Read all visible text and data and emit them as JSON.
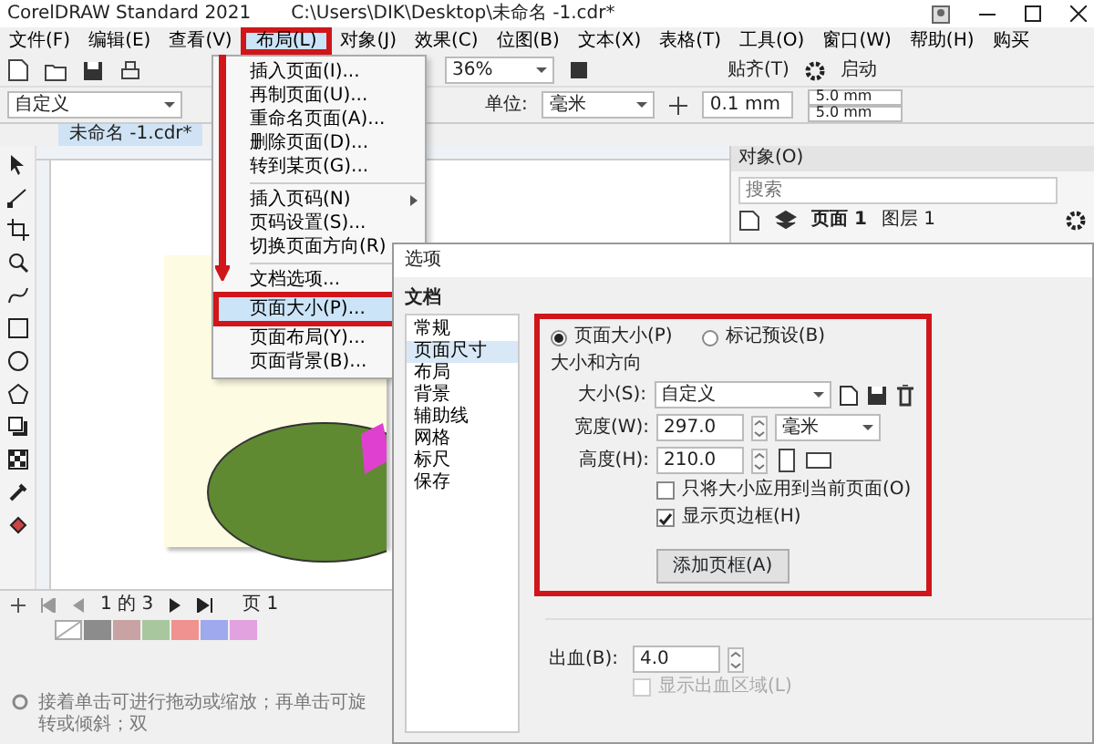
{
  "window": {
    "app_title": "CorelDRAW Standard 2021",
    "file_path": "C:\\Users\\DIK\\Desktop\\未命名 -1.cdr*"
  },
  "menu_bar": [
    {
      "label": "文件(F)",
      "selected": false
    },
    {
      "label": "编辑(E)",
      "selected": false
    },
    {
      "label": "查看(V)",
      "selected": false
    },
    {
      "label": "布局(L)",
      "selected": true
    },
    {
      "label": "对象(J)",
      "selected": false
    },
    {
      "label": "效果(C)",
      "selected": false
    },
    {
      "label": "位图(B)",
      "selected": false
    },
    {
      "label": "文本(X)",
      "selected": false
    },
    {
      "label": "表格(T)",
      "selected": false
    },
    {
      "label": "工具(O)",
      "selected": false
    },
    {
      "label": "窗口(W)",
      "selected": false
    },
    {
      "label": "帮助(H)",
      "selected": false
    },
    {
      "label": "购买",
      "selected": false
    }
  ],
  "toolbar": {
    "zoom": "36%",
    "snap": "贴齐(T)",
    "launch": "启动"
  },
  "property_bar": {
    "preset": "自定义",
    "unit_label": "单位:",
    "unit": "毫米",
    "nudge": "0.1 mm",
    "duplicate_x": "5.0 mm",
    "duplicate_y": "5.0 mm"
  },
  "document_tab": "未命名 -1.cdr*",
  "objects_docker": {
    "title": "对象(O)",
    "search_placeholder": "搜索",
    "page": "页面 1",
    "layer": "图层 1"
  },
  "page_nav": {
    "position": "1 的 3",
    "page_tab": "页 1"
  },
  "palette": [
    {
      "color": "#8c8c8c"
    },
    {
      "color": "#c9a3a3"
    },
    {
      "color": "#a9c79f"
    },
    {
      "color": "#f0928f"
    },
    {
      "color": "#9fa9ee"
    },
    {
      "color": "#e2a2e0"
    }
  ],
  "status_bar": "接着单击可进行拖动或缩放；再单击可旋转或倾斜；双",
  "layout_menu": [
    {
      "kind": "item",
      "label": "插入页面(I)...",
      "selected": false
    },
    {
      "kind": "item",
      "label": "再制页面(U)...",
      "selected": false
    },
    {
      "kind": "item",
      "label": "重命名页面(A)...",
      "selected": false
    },
    {
      "kind": "item",
      "label": "删除页面(D)...",
      "selected": false
    },
    {
      "kind": "item",
      "label": "转到某页(G)...",
      "selected": false
    },
    {
      "kind": "separator"
    },
    {
      "kind": "submenu",
      "label": "插入页码(N)",
      "selected": false
    },
    {
      "kind": "item",
      "label": "页码设置(S)...",
      "selected": false
    },
    {
      "kind": "item",
      "label": "切换页面方向(R)",
      "selected": false
    },
    {
      "kind": "separator"
    },
    {
      "kind": "item",
      "label": "文档选项...",
      "selected": false
    },
    {
      "kind": "item",
      "label": "页面大小(P)...",
      "selected": true
    },
    {
      "kind": "item",
      "label": "页面布局(Y)...",
      "selected": false
    },
    {
      "kind": "item",
      "label": "页面背景(B)...",
      "selected": false
    }
  ],
  "dialog": {
    "title": "选项",
    "section": "文档",
    "categories": [
      {
        "label": "常规",
        "selected": false
      },
      {
        "label": "页面尺寸",
        "selected": true
      },
      {
        "label": "布局",
        "selected": false
      },
      {
        "label": "背景",
        "selected": false
      },
      {
        "label": "辅助线",
        "selected": false
      },
      {
        "label": "网格",
        "selected": false
      },
      {
        "label": "标尺",
        "selected": false
      },
      {
        "label": "保存",
        "selected": false
      }
    ],
    "radios": [
      {
        "label": "页面大小(P)",
        "selected": true
      },
      {
        "label": "标记预设(B)",
        "selected": false
      }
    ],
    "group_title": "大小和方向",
    "size_label": "大小(S):",
    "size_value": "自定义",
    "width_label": "宽度(W):",
    "width_value": "297.0",
    "units": "毫米",
    "height_label": "高度(H):",
    "height_value": "210.0",
    "checkboxes": [
      {
        "label": "只将大小应用到当前页面(O)",
        "checked": false,
        "disabled": false
      },
      {
        "label": "显示页边框(H)",
        "checked": true,
        "disabled": false
      }
    ],
    "add_frame_button": "添加页框(A)",
    "bleed_label": "出血(B):",
    "bleed_value": "4.0",
    "bleed_checkbox": {
      "label": "显示出血区域(L)",
      "checked": false,
      "disabled": true
    }
  }
}
